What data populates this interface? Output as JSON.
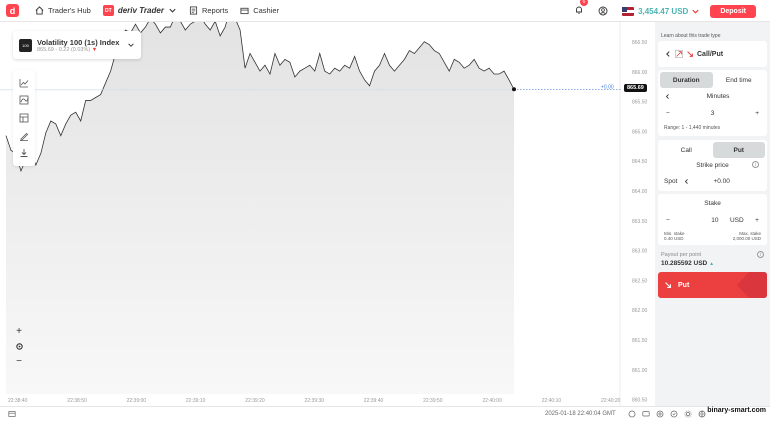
{
  "nav": {
    "traders_hub": "Trader's Hub",
    "dtrader_badge": "DT",
    "dtrader": "deriv Trader",
    "reports": "Reports",
    "cashier": "Cashier",
    "notification_count": "6",
    "balance": "3,454.47 USD",
    "deposit": "Deposit"
  },
  "symbol": {
    "icon": "100",
    "name": "Volatility 100 (1s) Index",
    "price": "865.69",
    "change": "- 0.22 (0.03%)"
  },
  "chart_data": {
    "type": "area",
    "current_price": "865.69",
    "current_offset_label": "+0.00",
    "y_ticks": [
      "866.50",
      "866.00",
      "865.50",
      "865.00",
      "864.50",
      "864.00",
      "863.50",
      "863.00",
      "862.50",
      "862.00",
      "861.50",
      "861.00",
      "860.50"
    ],
    "x_ticks": [
      "22:38:40",
      "22:38:50",
      "22:39:00",
      "22:39:10",
      "22:39:20",
      "22:39:30",
      "22:39:40",
      "22:39:50",
      "22:40:00",
      "22:40:10",
      "22:40:20"
    ],
    "series": [
      {
        "values": [
          864.9,
          864.65,
          864.6,
          864.3,
          864.5,
          864.6,
          864.4,
          864.6,
          864.95,
          865.15,
          865.1,
          864.9,
          865.1,
          865.25,
          865.3,
          865.15,
          865.5,
          865.5,
          865.55,
          865.6,
          865.8,
          866.0,
          866.3,
          866.55,
          866.7,
          866.65,
          866.8,
          866.65,
          866.75,
          866.9,
          866.8,
          866.65,
          866.75,
          866.75,
          866.95,
          866.85,
          866.7,
          866.8,
          866.85,
          866.95,
          866.8,
          866.7,
          866.85,
          866.6,
          866.75,
          867.05,
          866.9,
          866.7,
          866.05,
          866.3,
          866.15,
          866.0,
          866.1,
          865.95,
          866.3,
          866.1,
          866.2,
          866.15,
          865.9,
          866.0,
          866.05,
          866.1,
          866.0,
          866.3,
          866.0,
          865.95,
          866.05,
          866.0,
          866.1,
          866.05,
          866.25,
          866.0,
          865.85,
          865.75,
          866.0,
          866.1,
          866.3,
          866.1,
          866.0,
          866.1,
          866.2,
          866.35,
          866.3,
          866.4,
          866.5,
          866.45,
          866.35,
          866.3,
          866.15,
          866.0,
          866.2,
          866.15,
          866.05,
          866.1,
          866.2,
          866.05,
          866.0,
          866.05,
          865.95,
          865.95,
          866.0,
          865.85,
          865.69
        ]
      }
    ],
    "ylim": [
      860.5,
      866.7
    ]
  },
  "footer": {
    "timestamp": "2025-01-18 22:40:04 GMT",
    "watermark": "binary-smart.com"
  },
  "panel": {
    "learn_about": "Learn about this trade type",
    "trade_type": "Call/Put",
    "duration_tab": "Duration",
    "endtime_tab": "End time",
    "duration_unit": "Minutes",
    "duration_value": "3",
    "duration_range": "Range: 1 - 1,440 minutes",
    "call_tab": "Call",
    "put_tab": "Put",
    "strike_title": "Strike price",
    "spot_label": "Spot",
    "spot_value": "+0.00",
    "stake_title": "Stake",
    "stake_value": "10",
    "stake_currency": "USD",
    "min_stake_label": "Min. stake",
    "min_stake_value": "0.40 USD",
    "max_stake_label": "Max. stake",
    "max_stake_value": "2,000.00 USD",
    "payout_label": "Payout per point",
    "payout_value": "10.285592 USD",
    "put_button": "Put"
  }
}
